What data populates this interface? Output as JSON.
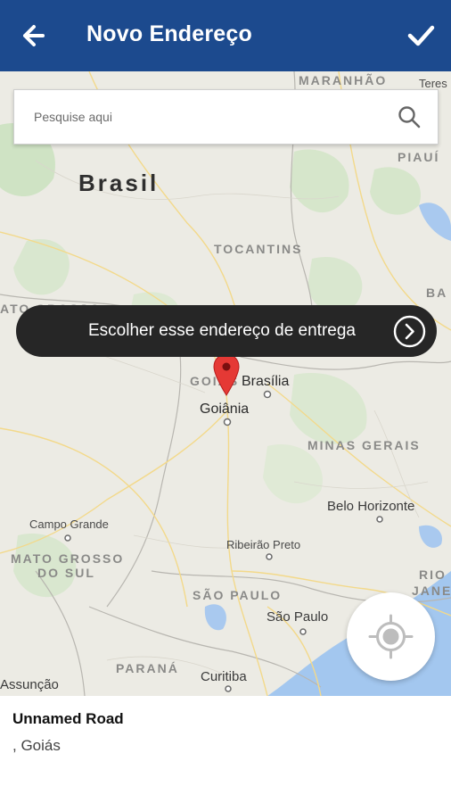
{
  "header": {
    "title": "Novo Endereço",
    "back_icon": "arrow-left-icon",
    "confirm_icon": "check-icon",
    "background": "#1c4a8e"
  },
  "search": {
    "placeholder": "Pesquise aqui",
    "icon": "search-icon"
  },
  "map": {
    "country": "Brasil",
    "states": [
      "MARANHÃO",
      "PIAUÍ",
      "TOCANTINS",
      "ATO GROSSO",
      "GOIÁS",
      "MINAS GERAIS",
      "MATO GROSSO",
      "DO SUL",
      "SÃO PAULO",
      "PARANÁ",
      "RIO",
      "JANE",
      "BA"
    ],
    "cities": [
      "Teres",
      "Brasília",
      "Goiânia",
      "Belo Horizonte",
      "Campo Grande",
      "Ribeirão Preto",
      "São Paulo",
      "Curitiba",
      "Assunção"
    ],
    "pin_icon": "map-pin-icon"
  },
  "action": {
    "label": "Escolher esse endereço de entrega",
    "icon": "chevron-right-circle-icon"
  },
  "locate": {
    "icon": "crosshair-icon"
  },
  "address": {
    "title": "Unnamed Road",
    "subtitle": ", Goiás"
  }
}
